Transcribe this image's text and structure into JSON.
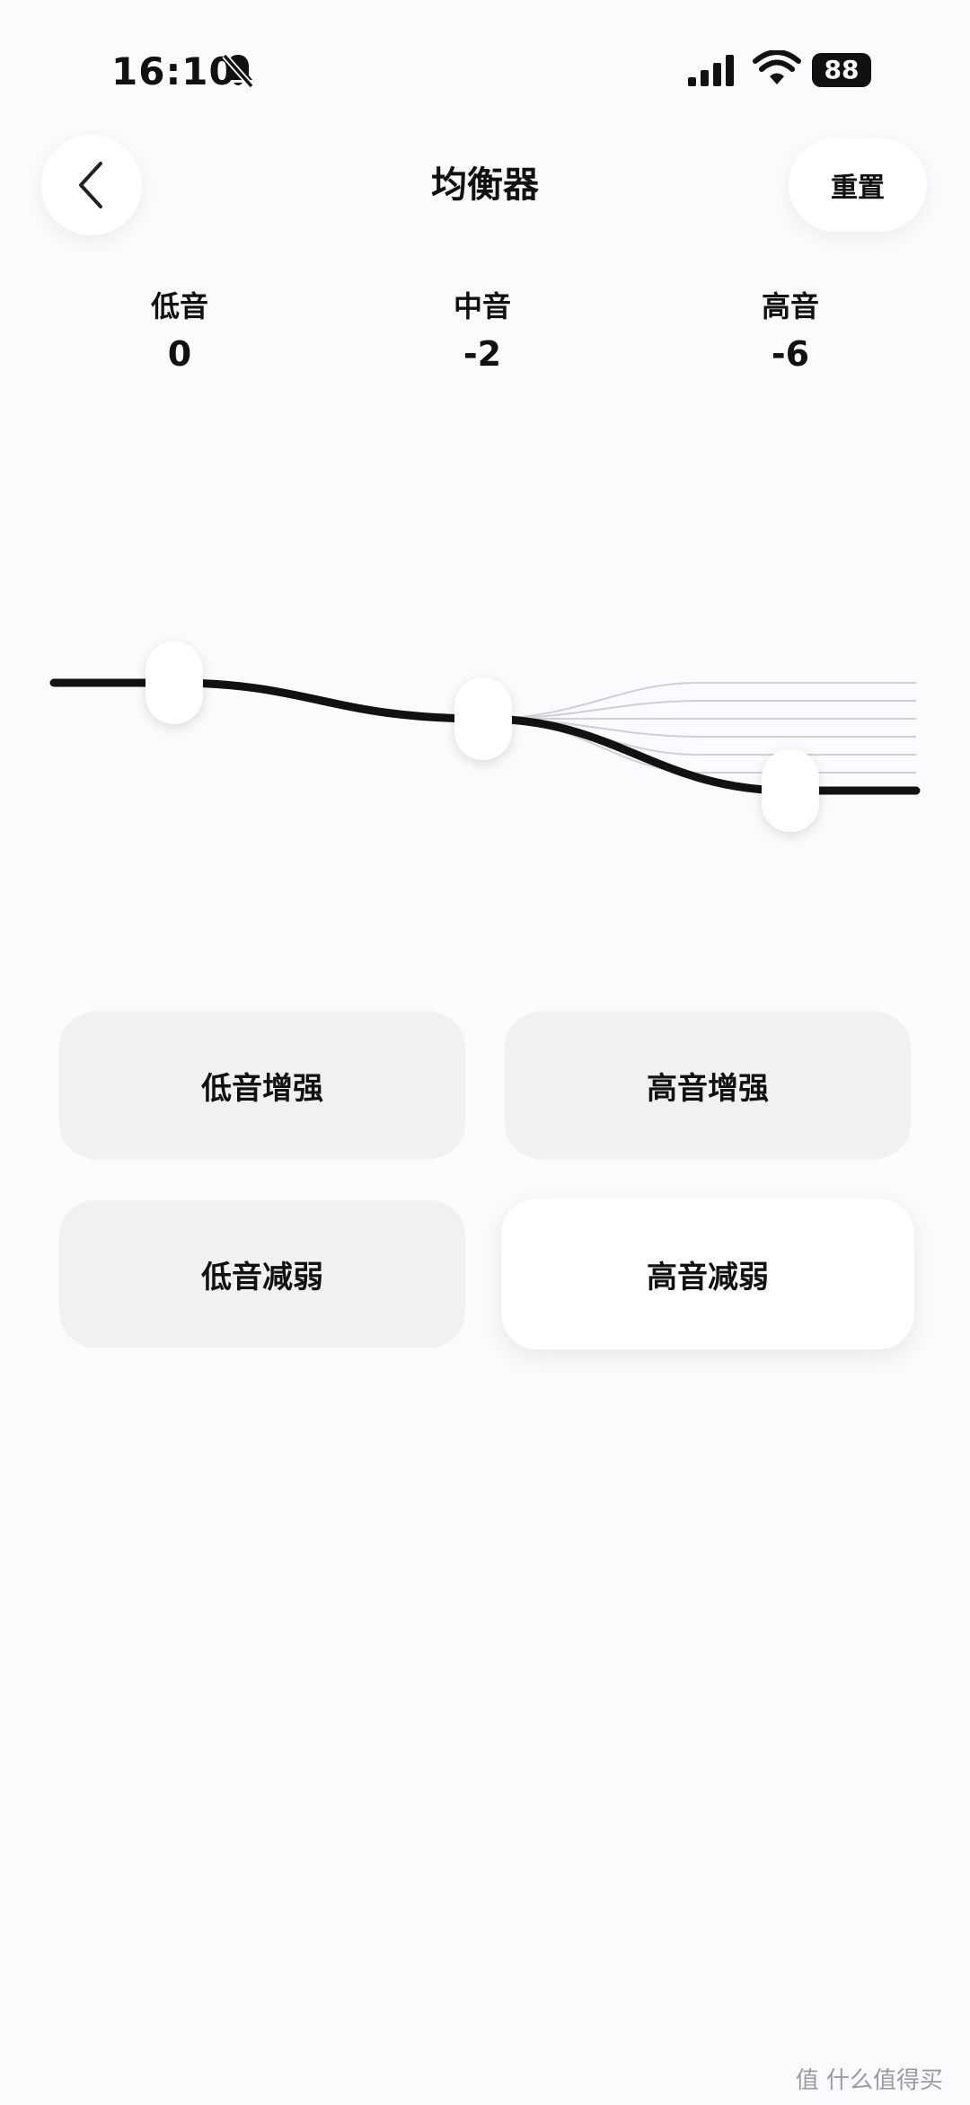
{
  "status_bar": {
    "time": "16:10",
    "battery": "88"
  },
  "header": {
    "title": "均衡器",
    "reset_label": "重置"
  },
  "bands": [
    {
      "label": "低音",
      "value": 0,
      "display": "0"
    },
    {
      "label": "中音",
      "value": -2,
      "display": "-2"
    },
    {
      "label": "高音",
      "value": -6,
      "display": "-6"
    }
  ],
  "presets": [
    {
      "label": "低音增强",
      "selected": false
    },
    {
      "label": "高音增强",
      "selected": false
    },
    {
      "label": "低音减弱",
      "selected": false
    },
    {
      "label": "高音减弱",
      "selected": true
    }
  ],
  "watermark": "值 什么值得买",
  "icons": {
    "back": "chevron-left-icon",
    "bell": "bell-slash-icon",
    "signal": "cellular-signal-icon",
    "wifi": "wifi-icon",
    "battery": "battery-icon"
  },
  "colors": {
    "background": "#fbfbfd",
    "curve": "#111111",
    "button_bg": "#f1f1f3",
    "button_selected_bg": "#ffffff"
  }
}
